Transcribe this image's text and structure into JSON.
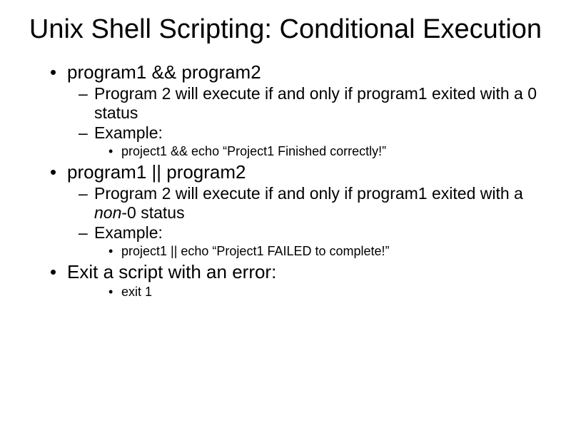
{
  "title": "Unix Shell Scripting: Conditional Execution",
  "bullets": [
    {
      "level": 1,
      "text": "program1 && program2"
    },
    {
      "level": 2,
      "text": "Program 2 will execute if and only if program1 exited with a 0 status"
    },
    {
      "level": 2,
      "text": "Example:"
    },
    {
      "level": 3,
      "text": "project1 && echo “Project1 Finished correctly!”"
    },
    {
      "level": 1,
      "text": "program1 || program2"
    },
    {
      "level": 2,
      "pre": "Program 2 will execute if and only if program1 exited with a ",
      "em": "non",
      "post": "-0 status"
    },
    {
      "level": 2,
      "text": "Example:"
    },
    {
      "level": 3,
      "text": "project1 || echo “Project1 FAILED to complete!”"
    },
    {
      "level": 1,
      "text": "Exit a script with an error:"
    },
    {
      "level": 3,
      "text": "exit 1"
    }
  ]
}
